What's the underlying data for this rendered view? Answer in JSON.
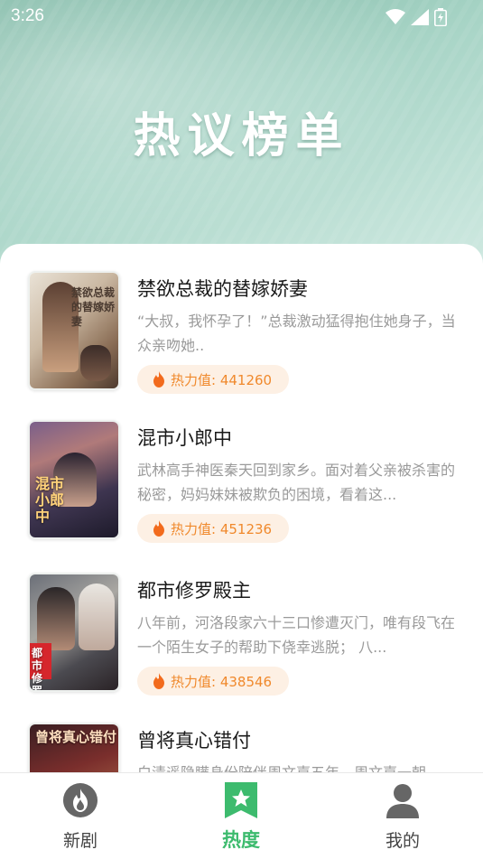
{
  "status_bar": {
    "time": "3:26"
  },
  "header": {
    "title": "热议榜单"
  },
  "items": [
    {
      "title": "禁欲总裁的替嫁娇妻",
      "desc": "“大叔，我怀孕了！”总裁激动猛得抱住她身子，当众亲吻她..",
      "heat_label": "热力值: 441260",
      "cover_text": "禁欲总裁的替嫁娇妻"
    },
    {
      "title": "混市小郎中",
      "desc": "武林高手神医秦天回到家乡。面对着父亲被杀害的秘密，妈妈妹妹被欺负的困境，看着这...",
      "heat_label": "热力值: 451236",
      "cover_text": "混市小郎中"
    },
    {
      "title": "都市修罗殿主",
      "desc": "八年前，河洛段家六十三口惨遭灭门，唯有段飞在一个陌生女子的帮助下侥幸逃脱； 八...",
      "heat_label": "热力值: 438546",
      "cover_text": "都市修罗殿主"
    },
    {
      "title": "曾将真心错付",
      "desc": "白清遥隐瞒身份陪伴周文嘉五年，周文嘉一朝",
      "heat_label": "",
      "cover_text": "曾将真心错付"
    }
  ],
  "tabbar": {
    "tabs": [
      {
        "label": "新剧",
        "icon": "fire-icon"
      },
      {
        "label": "热度",
        "icon": "star-bookmark-icon"
      },
      {
        "label": "我的",
        "icon": "person-icon"
      }
    ],
    "active_color": "#3dbb6e"
  }
}
